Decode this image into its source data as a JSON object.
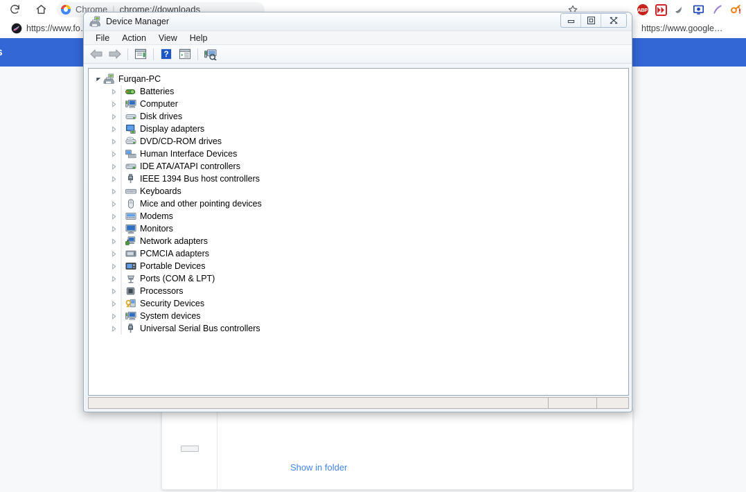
{
  "browser": {
    "name": "Chrome",
    "omnibox_url": "chrome://downloads",
    "nav_icons": [
      "reload-icon",
      "home-icon"
    ],
    "star_icon": "bookmark-star-icon",
    "extensions": [
      {
        "name": "adblock-plus-extension-icon",
        "label": "ABP"
      },
      {
        "name": "fast-forward-extension-icon",
        "label": ""
      },
      {
        "name": "ink-drop-extension-icon",
        "label": ""
      },
      {
        "name": "monitor-extension-icon",
        "label": ""
      },
      {
        "name": "feather-pen-extension-icon",
        "label": ""
      },
      {
        "name": "key-alert-extension-icon",
        "label": ""
      }
    ],
    "bookmarks": [
      {
        "name": "bookmark-forum",
        "label": "https://www.fo…"
      },
      {
        "name": "bookmark-google",
        "label": "https://www.google…"
      }
    ],
    "downloads_page": {
      "header_title": "loads",
      "show_in_folder_label": "Show in folder"
    },
    "colors": {
      "header_blue": "#3367d6",
      "link_blue": "#4285f4",
      "page_bg": "#f7f8fa"
    }
  },
  "device_manager": {
    "title": "Device Manager",
    "title_icon": "computer-printer-icon",
    "window_buttons": [
      {
        "name": "minimize-button",
        "glyph": "minimize-glyph"
      },
      {
        "name": "restore-button",
        "glyph": "restore-glyph"
      },
      {
        "name": "close-button",
        "glyph": "close-glyph"
      }
    ],
    "menus": [
      "File",
      "Action",
      "View",
      "Help"
    ],
    "toolbar": [
      {
        "name": "back-button",
        "icon": "back-arrow-icon"
      },
      {
        "name": "forward-button",
        "icon": "forward-arrow-icon"
      },
      {
        "name": "properties-button",
        "icon": "properties-icon"
      },
      {
        "name": "help-button",
        "icon": "help-question-icon"
      },
      {
        "name": "show-hide-console-tree-button",
        "icon": "console-tree-icon"
      },
      {
        "name": "scan-hardware-changes-button",
        "icon": "scan-hardware-icon"
      }
    ],
    "tree": {
      "root": {
        "label": "Furqan-PC",
        "icon": "computer-root-icon",
        "expanded": true
      },
      "items": [
        {
          "label": "Batteries",
          "icon": "battery-icon"
        },
        {
          "label": "Computer",
          "icon": "computer-icon"
        },
        {
          "label": "Disk drives",
          "icon": "disk-drive-icon"
        },
        {
          "label": "Display adapters",
          "icon": "display-adapter-icon"
        },
        {
          "label": "DVD/CD-ROM drives",
          "icon": "dvd-drive-icon"
        },
        {
          "label": "Human Interface Devices",
          "icon": "hid-icon"
        },
        {
          "label": "IDE ATA/ATAPI controllers",
          "icon": "ide-controller-icon"
        },
        {
          "label": "IEEE 1394 Bus host controllers",
          "icon": "ieee1394-icon"
        },
        {
          "label": "Keyboards",
          "icon": "keyboard-icon"
        },
        {
          "label": "Mice and other pointing devices",
          "icon": "mouse-icon"
        },
        {
          "label": "Modems",
          "icon": "modem-icon"
        },
        {
          "label": "Monitors",
          "icon": "monitor-icon"
        },
        {
          "label": "Network adapters",
          "icon": "network-adapter-icon"
        },
        {
          "label": "PCMCIA adapters",
          "icon": "pcmcia-icon"
        },
        {
          "label": "Portable Devices",
          "icon": "portable-device-icon"
        },
        {
          "label": "Ports (COM & LPT)",
          "icon": "port-icon"
        },
        {
          "label": "Processors",
          "icon": "processor-icon"
        },
        {
          "label": "Security Devices",
          "icon": "security-key-icon"
        },
        {
          "label": "System devices",
          "icon": "system-device-icon"
        },
        {
          "label": "Universal Serial Bus controllers",
          "icon": "usb-controller-icon"
        }
      ]
    },
    "status_bar": {
      "pane1": "",
      "pane2": "",
      "pane3": ""
    }
  }
}
